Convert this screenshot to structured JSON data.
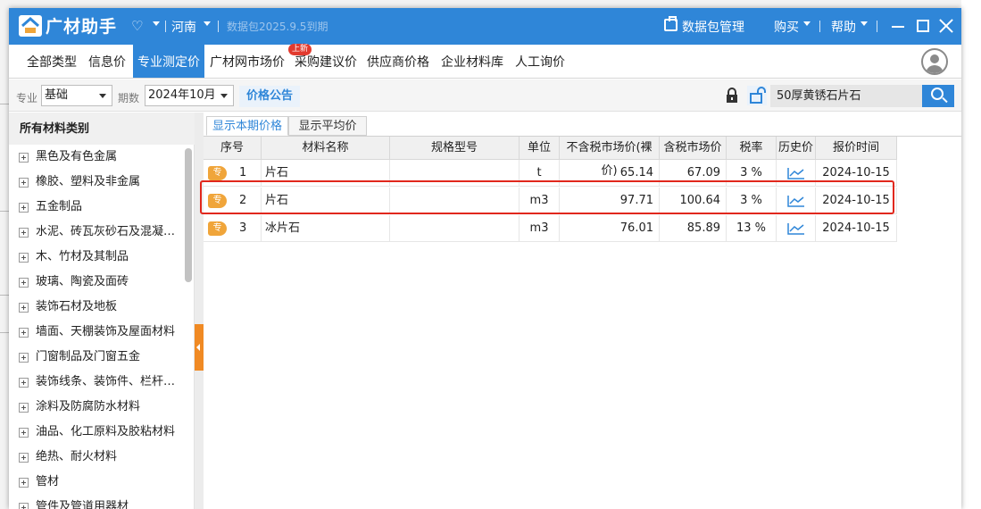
{
  "titlebar": {
    "app_title": "广材助手",
    "vip_icon": "diamond-icon",
    "region": "河南",
    "expiry": "数据包2025.9.5到期",
    "package_manage": "数据包管理",
    "buy": "购买",
    "help": "帮助"
  },
  "nav": {
    "tabs": [
      {
        "label": "全部类型"
      },
      {
        "label": "信息价"
      },
      {
        "label": "专业测定价"
      },
      {
        "label": "广材网市场价"
      },
      {
        "label": "采购建议价"
      },
      {
        "label": "供应商价格"
      },
      {
        "label": "企业材料库"
      },
      {
        "label": "人工询价"
      }
    ],
    "active_tab": "专业测定价",
    "new_badge": "上新"
  },
  "filters": {
    "major_label": "专业",
    "major_value": "基础",
    "period_label": "期数",
    "period_value": "2024年10月",
    "price_notice": "价格公告",
    "search_value": "50厚黄锈石片石"
  },
  "sidebar": {
    "header": "所有材料类别",
    "categories": [
      "黑色及有色金属",
      "橡胶、塑料及非金属",
      "五金制品",
      "水泥、砖瓦灰砂石及混凝…",
      "木、竹材及其制品",
      "玻璃、陶瓷及面砖",
      "装饰石材及地板",
      "墙面、天棚装饰及屋面材料",
      "门窗制品及门窗五金",
      "装饰线条、装饰件、栏杆…",
      "涂料及防腐防水材料",
      "油品、化工原料及胶粘材料",
      "绝热、耐火材料",
      "管材",
      "管件及管道用器材"
    ]
  },
  "content": {
    "subtabs": [
      "显示本期价格",
      "显示平均价"
    ],
    "columns": [
      "序号",
      "材料名称",
      "规格型号",
      "单位",
      "不含税市场价(裸价)",
      "含税市场价",
      "税率",
      "历史价",
      "报价时间"
    ],
    "rows": [
      {
        "tag": "专",
        "no": "1",
        "name": "片石",
        "spec": "",
        "unit": "t",
        "price_ex": "65.14",
        "price_in": "67.09",
        "tax": "3 %",
        "date": "2024-10-15"
      },
      {
        "tag": "专",
        "no": "2",
        "name": "片石",
        "spec": "",
        "unit": "m3",
        "price_ex": "97.71",
        "price_in": "100.64",
        "tax": "3 %",
        "date": "2024-10-15"
      },
      {
        "tag": "专",
        "no": "3",
        "name": "冰片石",
        "spec": "",
        "unit": "m3",
        "price_ex": "76.01",
        "price_in": "85.89",
        "tax": "13 %",
        "date": "2024-10-15"
      }
    ],
    "highlight_color": "#e1271c"
  },
  "colors": {
    "brand": "#2f86d8",
    "tag_orange": "#f0a53a",
    "collapse_orange": "#f08a24"
  }
}
